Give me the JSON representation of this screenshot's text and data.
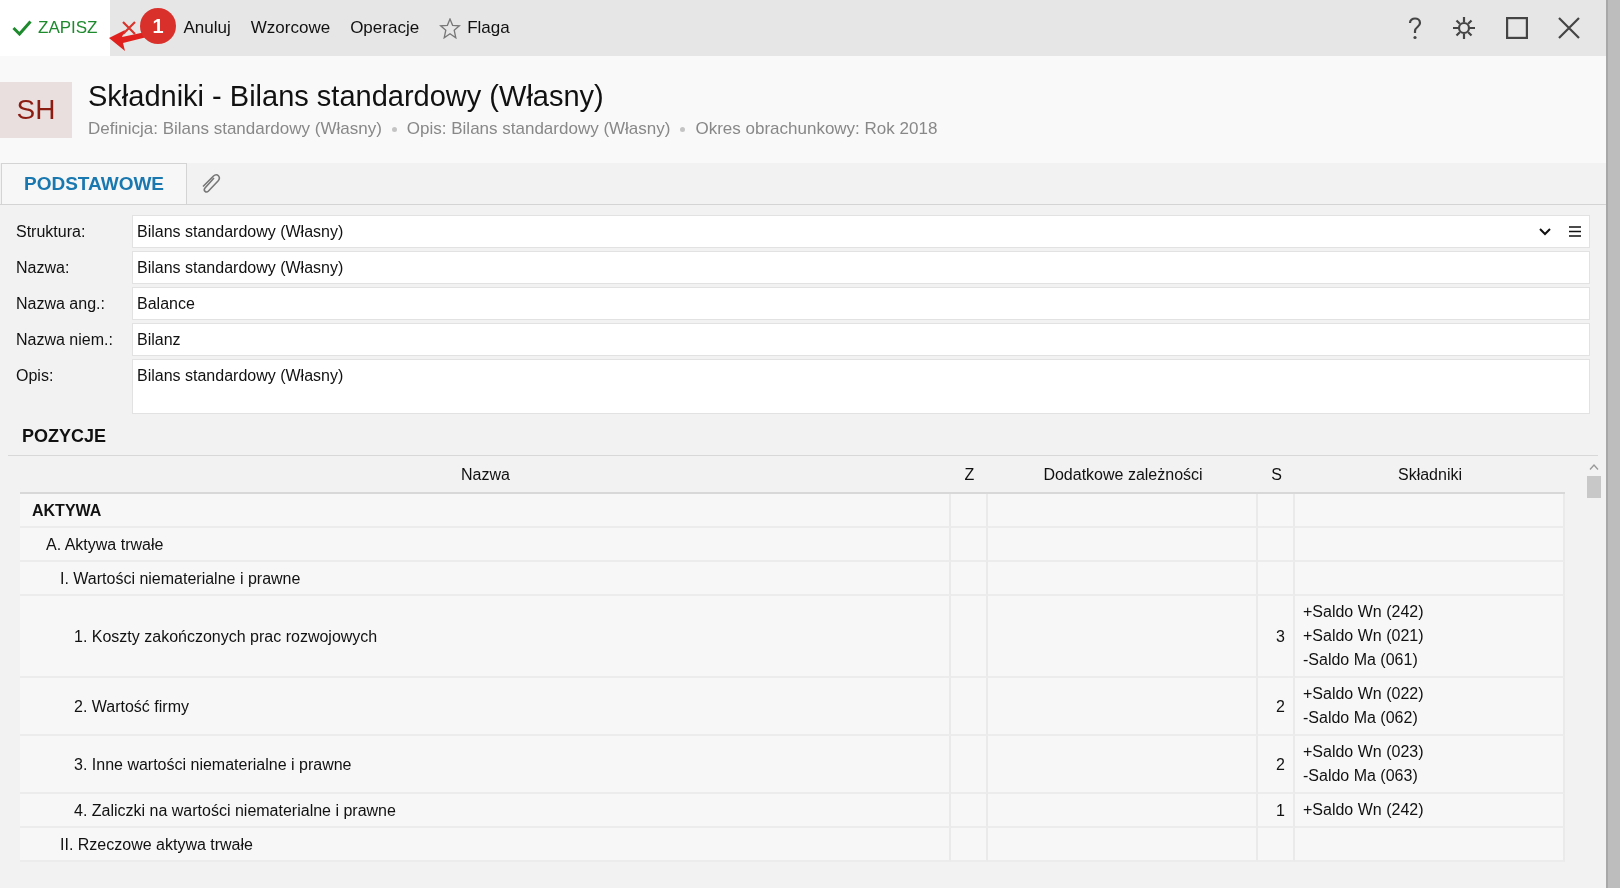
{
  "toolbar": {
    "buttons": [
      {
        "label": "ZAPISZ",
        "kind": "save"
      },
      {
        "label": "Anuluj",
        "kind": "cancel"
      },
      {
        "label": "Wzorcowe",
        "kind": "plain"
      },
      {
        "label": "Operacje",
        "kind": "plain"
      },
      {
        "label": "Flaga",
        "kind": "flag"
      }
    ],
    "annotation": {
      "label": "1"
    }
  },
  "header": {
    "avatar": "SH",
    "title": "Składniki - Bilans standardowy (Własny)",
    "meta": [
      "Definicja: Bilans standardowy (Własny)",
      "Opis: Bilans standardowy (Własny)",
      "Okres obrachunkowy: Rok 2018"
    ]
  },
  "tabs": [
    {
      "label": "PODSTAWOWE",
      "kind": "text",
      "selected": true
    },
    {
      "kind": "attachment",
      "selected": false
    }
  ],
  "form": [
    {
      "label": "Struktura:",
      "value": "Bilans standardowy (Własny)",
      "kind": "select"
    },
    {
      "label": "Nazwa:",
      "value": "Bilans standardowy (Własny)",
      "kind": "text"
    },
    {
      "label": "Nazwa ang.:",
      "value": "Balance",
      "kind": "text"
    },
    {
      "label": "Nazwa niem.:",
      "value": "Bilanz",
      "kind": "text"
    },
    {
      "label": "Opis:",
      "value": "Bilans standardowy (Własny)",
      "kind": "textarea"
    }
  ],
  "section_title": "POZYCJE",
  "table": {
    "columns": [
      "Nazwa",
      "Z",
      "Dodatkowe zależności",
      "S",
      "Składniki"
    ],
    "rows": [
      {
        "name": "AKTYWA",
        "children": [
          {
            "name": "A. Aktywa trwałe",
            "children": [
              {
                "name": "I. Wartości niematerialne i prawne",
                "children": [
                  {
                    "name": "1. Koszty zakończonych prac rozwojowych",
                    "s": "3",
                    "items": [
                      "+Saldo Wn (242)",
                      "+Saldo Wn (021)",
                      "-Saldo Ma (061)"
                    ]
                  },
                  {
                    "name": "2. Wartość firmy",
                    "s": "2",
                    "items": [
                      "+Saldo Wn (022)",
                      "-Saldo Ma (062)"
                    ]
                  },
                  {
                    "name": "3. Inne wartości niematerialne i prawne",
                    "s": "2",
                    "items": [
                      "+Saldo Wn (023)",
                      "-Saldo Ma (063)"
                    ]
                  },
                  {
                    "name": "4. Zaliczki na wartości niematerialne i prawne",
                    "s": "1",
                    "items": [
                      "+Saldo Wn (242)"
                    ]
                  }
                ]
              },
              {
                "name": "II. Rzeczowe aktywa trwałe"
              }
            ]
          }
        ]
      }
    ]
  }
}
